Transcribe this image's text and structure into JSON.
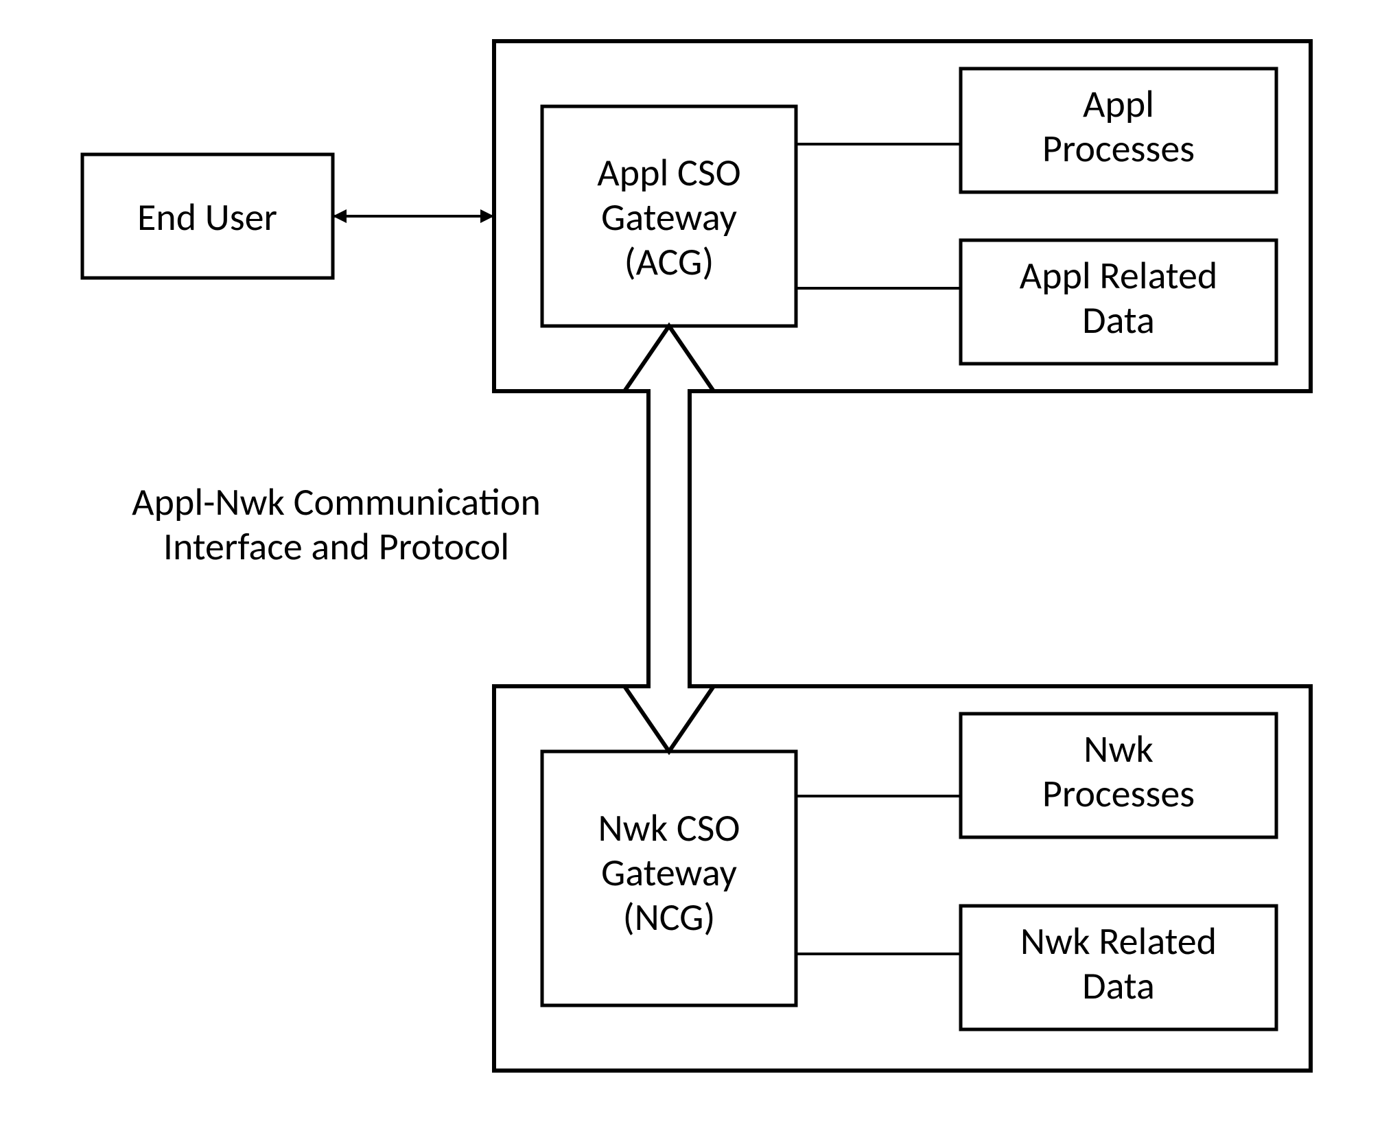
{
  "end_user": {
    "label": "End User"
  },
  "upper": {
    "gateway": {
      "line1": "Appl CSO",
      "line2": "Gateway",
      "line3": "(ACG)"
    },
    "proc": {
      "line1": "Appl",
      "line2": "Processes"
    },
    "data": {
      "line1": "Appl Related",
      "line2": "Data"
    }
  },
  "lower": {
    "gateway": {
      "line1": "Nwk CSO",
      "line2": "Gateway",
      "line3": "(NCG)"
    },
    "proc": {
      "line1": "Nwk",
      "line2": "Processes"
    },
    "data": {
      "line1": "Nwk Related",
      "line2": "Data"
    }
  },
  "interface_label": {
    "line1": "Appl-Nwk Communication",
    "line2": "Interface and Protocol"
  }
}
